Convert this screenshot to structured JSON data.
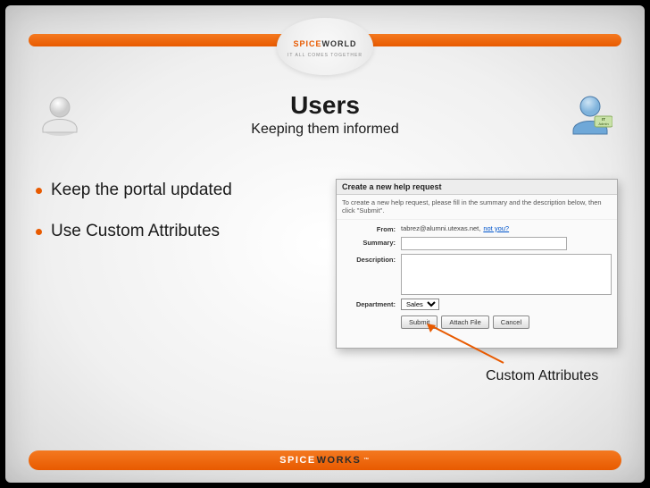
{
  "brand_top": {
    "line1": "SPICE",
    "line2": "WORLD",
    "arc": "IT ALL COMES TOGETHER"
  },
  "title": "Users",
  "subtitle": "Keeping them informed",
  "bullets": [
    "Keep the portal updated",
    "Use Custom Attributes"
  ],
  "form": {
    "header": "Create a new help request",
    "explain": "To create a new help request, please fill in the summary and the description below, then click \"Submit\".",
    "labels": {
      "from": "From:",
      "summary": "Summary:",
      "description": "Description:",
      "department": "Department:"
    },
    "from_value": "tabrez@alumni.utexas.net,",
    "from_notyou": "not you?",
    "department_value": "Sales",
    "buttons": {
      "submit": "Submit",
      "attach": "Attach File",
      "cancel": "Cancel"
    }
  },
  "callout": "Custom Attributes",
  "it_admin_label": "IT\nAdmin",
  "footer": {
    "part1": "SPICE",
    "part2": "WORKS",
    "tm": "™"
  }
}
